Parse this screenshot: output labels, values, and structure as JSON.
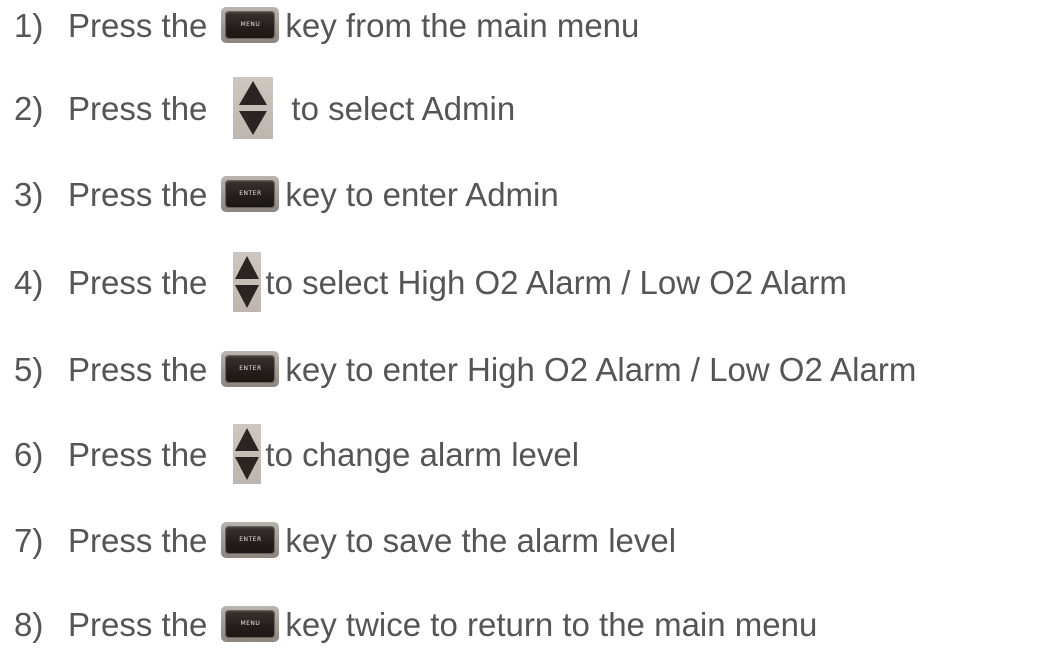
{
  "steps": [
    {
      "number": "1)",
      "press": "Press the",
      "key": "MENU",
      "key_icon": "menu-key-icon",
      "rest": "key from the main menu"
    },
    {
      "number": "2)",
      "press": "Press the",
      "key": "",
      "key_icon": "up-down-arrows-icon",
      "rest": "to select Admin"
    },
    {
      "number": "3)",
      "press": "Press the",
      "key": "ENTER",
      "key_icon": "enter-key-icon",
      "rest": "key to enter Admin"
    },
    {
      "number": "4)",
      "press": "Press the",
      "key": "",
      "key_icon": "up-down-arrows-icon",
      "rest": "to select High O2 Alarm / Low O2 Alarm"
    },
    {
      "number": "5)",
      "press": "Press the",
      "key": "ENTER",
      "key_icon": "enter-key-icon",
      "rest": "key to enter High O2 Alarm / Low O2 Alarm"
    },
    {
      "number": "6)",
      "press": "Press the",
      "key": "",
      "key_icon": "up-down-arrows-icon",
      "rest": "to change alarm level"
    },
    {
      "number": "7)",
      "press": "Press the",
      "key": "ENTER",
      "key_icon": "enter-key-icon",
      "rest": "key to save the alarm level"
    },
    {
      "number": "8)",
      "press": "Press the",
      "key": "MENU",
      "key_icon": "menu-key-icon",
      "rest": "key twice to return to the main menu"
    }
  ],
  "colors": {
    "text": "#555555",
    "key_face": "#231e1c",
    "key_bezel": "#9f9891",
    "arrow_pad": "#c4bdb5"
  }
}
